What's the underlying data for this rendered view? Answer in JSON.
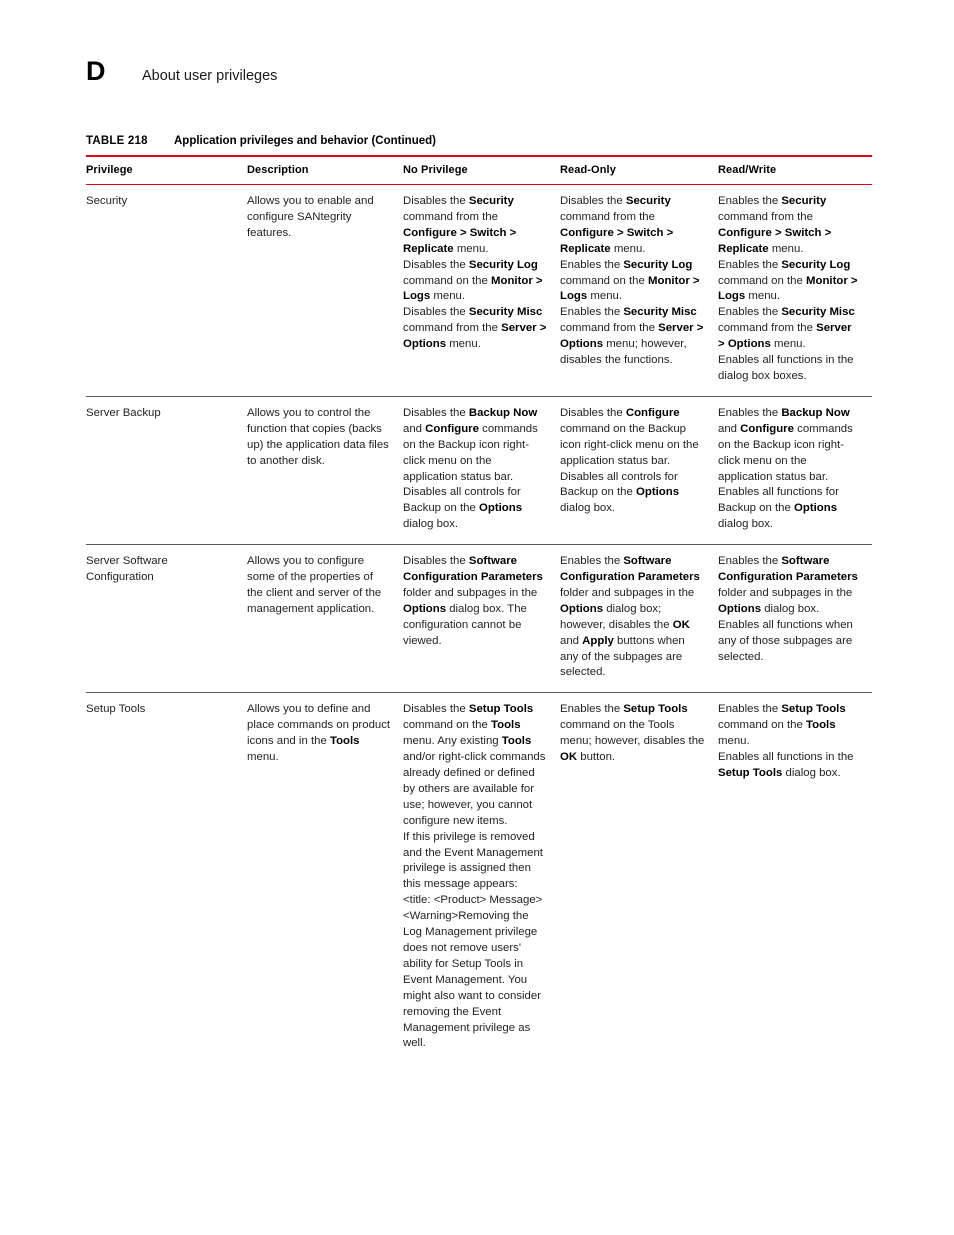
{
  "page": {
    "chapter_letter": "D",
    "chapter_title": "About user privileges"
  },
  "table": {
    "number": "TABLE 218",
    "title": "Application privileges and behavior (Continued)",
    "accent_color": "#e00018",
    "rule_color": "#58585a",
    "columns": [
      "Privilege",
      "Description",
      "No Privilege",
      "Read-Only",
      "Read/Write"
    ],
    "rows": [
      {
        "privilege": "Security",
        "description": [
          "Allows you to enable and configure SANtegrity features."
        ],
        "no_privilege": [
          "Disables the <b>Security</b> command from the <b>Configure &gt; Switch &gt; Replicate</b> menu.",
          "Disables the <b>Security Log</b> command on the <b>Monitor &gt; Logs</b> menu.",
          "Disables the <b>Security Misc</b> command from the <b>Server &gt; Options</b> menu."
        ],
        "read_only": [
          "Disables the <b>Security</b> command from the <b>Configure &gt; Switch &gt; Replicate</b> menu.",
          "Enables the <b>Security Log</b> command on the <b>Monitor &gt; Logs</b> menu.",
          "Enables the <b>Security Misc</b> command from the <b>Server &gt; Options</b> menu; however, disables the functions."
        ],
        "read_write": [
          "Enables the <b>Security</b> command from the <b>Configure &gt; Switch &gt; Replicate</b> menu.",
          "Enables the <b>Security Log</b> command on the <b>Monitor &gt; Logs</b> menu.",
          "Enables the <b>Security Misc</b> command from the <b>Server &gt; Options</b> menu.",
          "Enables all functions in the dialog box boxes."
        ]
      },
      {
        "privilege": "Server Backup",
        "description": [
          "Allows you to control the function that copies (backs up) the application data files to another disk."
        ],
        "no_privilege": [
          "Disables the <b>Backup Now</b> and <b>Configure</b> commands on the Backup icon right-click menu on the application status bar.",
          "Disables all controls for Backup on the <b>Options</b> dialog box."
        ],
        "read_only": [
          "Disables the <b>Configure</b> command on the Backup icon right-click menu on the application status bar.",
          "Disables all controls for Backup on the <b>Options</b> dialog box."
        ],
        "read_write": [
          "Enables the <b>Backup Now</b> and <b>Configure</b> commands on the Backup icon right-click menu on the application status bar.",
          "Enables all functions for Backup on the <b>Options</b> dialog box."
        ]
      },
      {
        "privilege": "Server Software Configuration",
        "description": [
          "Allows you to configure some of the properties of the client and server of the management application."
        ],
        "no_privilege": [
          "Disables the <b>Software Configuration Parameters</b> folder and subpages in the <b>Options</b> dialog box. The configuration cannot be viewed."
        ],
        "read_only": [
          "Enables the <b>Software Configuration Parameters</b> folder and subpages in the <b>Options</b> dialog box; however, disables the <b>OK</b> and <b>Apply</b> buttons when any of the subpages are selected."
        ],
        "read_write": [
          "Enables the <b>Software Configuration Parameters</b> folder and subpages in the <b>Options</b> dialog box.",
          "Enables all functions when any of those subpages are selected."
        ]
      },
      {
        "privilege": "Setup Tools",
        "description": [
          "Allows you to define and place commands on product icons and in the <b>Tools</b> menu."
        ],
        "no_privilege": [
          "Disables the <b>Setup Tools</b> command on the <b>Tools</b> menu. Any existing <b>Tools</b> and/or right-click commands already defined or defined by others are available for use; however, you cannot configure new items.",
          "If this privilege is removed and the Event Management privilege is assigned then this message appears:",
          "&lt;title: &lt;Product&gt; Message&gt;",
          "&lt;Warning&gt;Removing the Log Management privilege does not remove users' ability for Setup Tools in Event Management. You might also want to consider removing the Event Management privilege as well."
        ],
        "read_only": [
          "Enables the <b>Setup Tools</b> command on the Tools menu; however, disables the <b>OK</b> button."
        ],
        "read_write": [
          "Enables the <b>Setup Tools</b> command on the <b>Tools</b> menu.",
          "Enables all functions in the <b>Setup Tools</b> dialog box."
        ]
      }
    ]
  }
}
